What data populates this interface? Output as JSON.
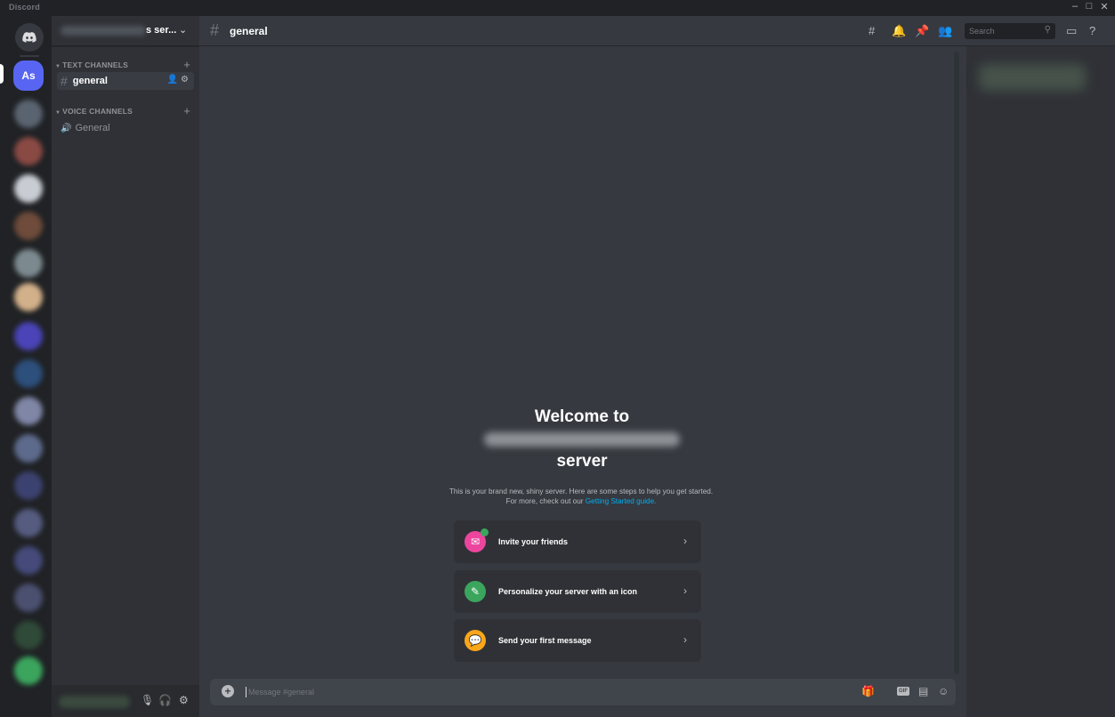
{
  "window": {
    "app_name": "Discord",
    "controls": [
      "–",
      "□",
      "✕"
    ]
  },
  "servers": {
    "active_initials": "As"
  },
  "sidebar": {
    "server_name_visible": "s ser...",
    "text_category": "TEXT CHANNELS",
    "voice_category": "VOICE CHANNELS",
    "text_channels": [
      {
        "name": "general",
        "active": true
      }
    ],
    "voice_channels": [
      {
        "name": "General"
      }
    ]
  },
  "header": {
    "channel_name": "general",
    "search_placeholder": "Search"
  },
  "welcome": {
    "line1": "Welcome to",
    "line3": "server",
    "description": "This is your brand new, shiny server. Here are some steps to help you get started. For more, check out our ",
    "link": "Getting Started guide."
  },
  "cards": [
    {
      "label": "Invite your friends",
      "icon": "invite-friends-icon",
      "color": "#eb459e"
    },
    {
      "label": "Personalize your server with an icon",
      "icon": "brush-icon",
      "color": "#3ba55d"
    },
    {
      "label": "Send your first message",
      "icon": "chat-bubble-icon",
      "color": "#faa61a"
    }
  ],
  "composer": {
    "placeholder": "Message #general",
    "buttons": [
      "gift-icon",
      "gif-button",
      "sticker-icon",
      "emoji-icon"
    ],
    "gif_label": "GIF"
  },
  "colors": {
    "accent": "#5865f2",
    "link": "#00aff4",
    "background": "#36393f",
    "sidebar": "#2f3136"
  }
}
